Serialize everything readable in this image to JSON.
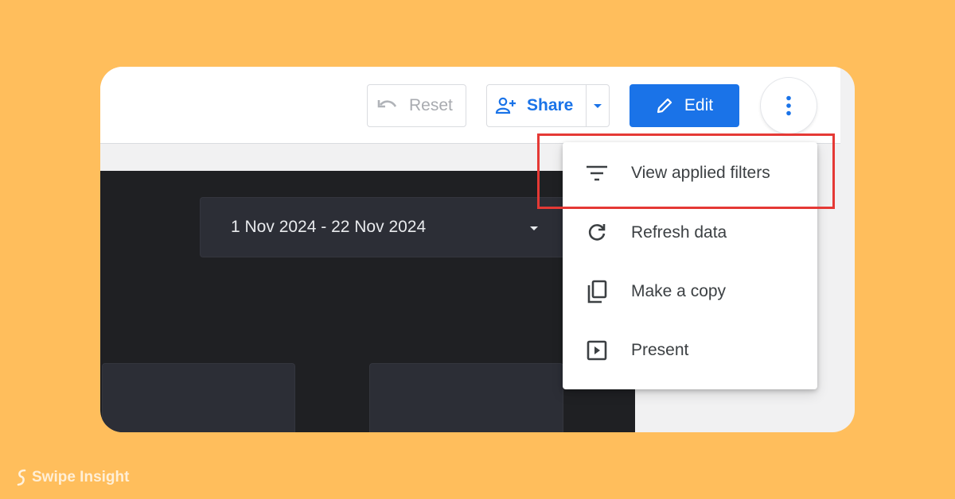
{
  "toolbar": {
    "reset_label": "Reset",
    "share_label": "Share",
    "edit_label": "Edit"
  },
  "report": {
    "date_range": "1 Nov 2024 - 22 Nov 2024"
  },
  "menu": {
    "items": [
      {
        "label": "View applied filters",
        "icon": "filter-list-icon"
      },
      {
        "label": "Refresh data",
        "icon": "refresh-icon"
      },
      {
        "label": "Make a copy",
        "icon": "copy-icon"
      },
      {
        "label": "Present",
        "icon": "present-icon"
      }
    ]
  },
  "brand": {
    "name": "Swipe Insight"
  },
  "colors": {
    "background": "#FFBE5C",
    "accent": "#1A73E8",
    "highlight": "#E53935",
    "canvas": "#1F2023"
  }
}
